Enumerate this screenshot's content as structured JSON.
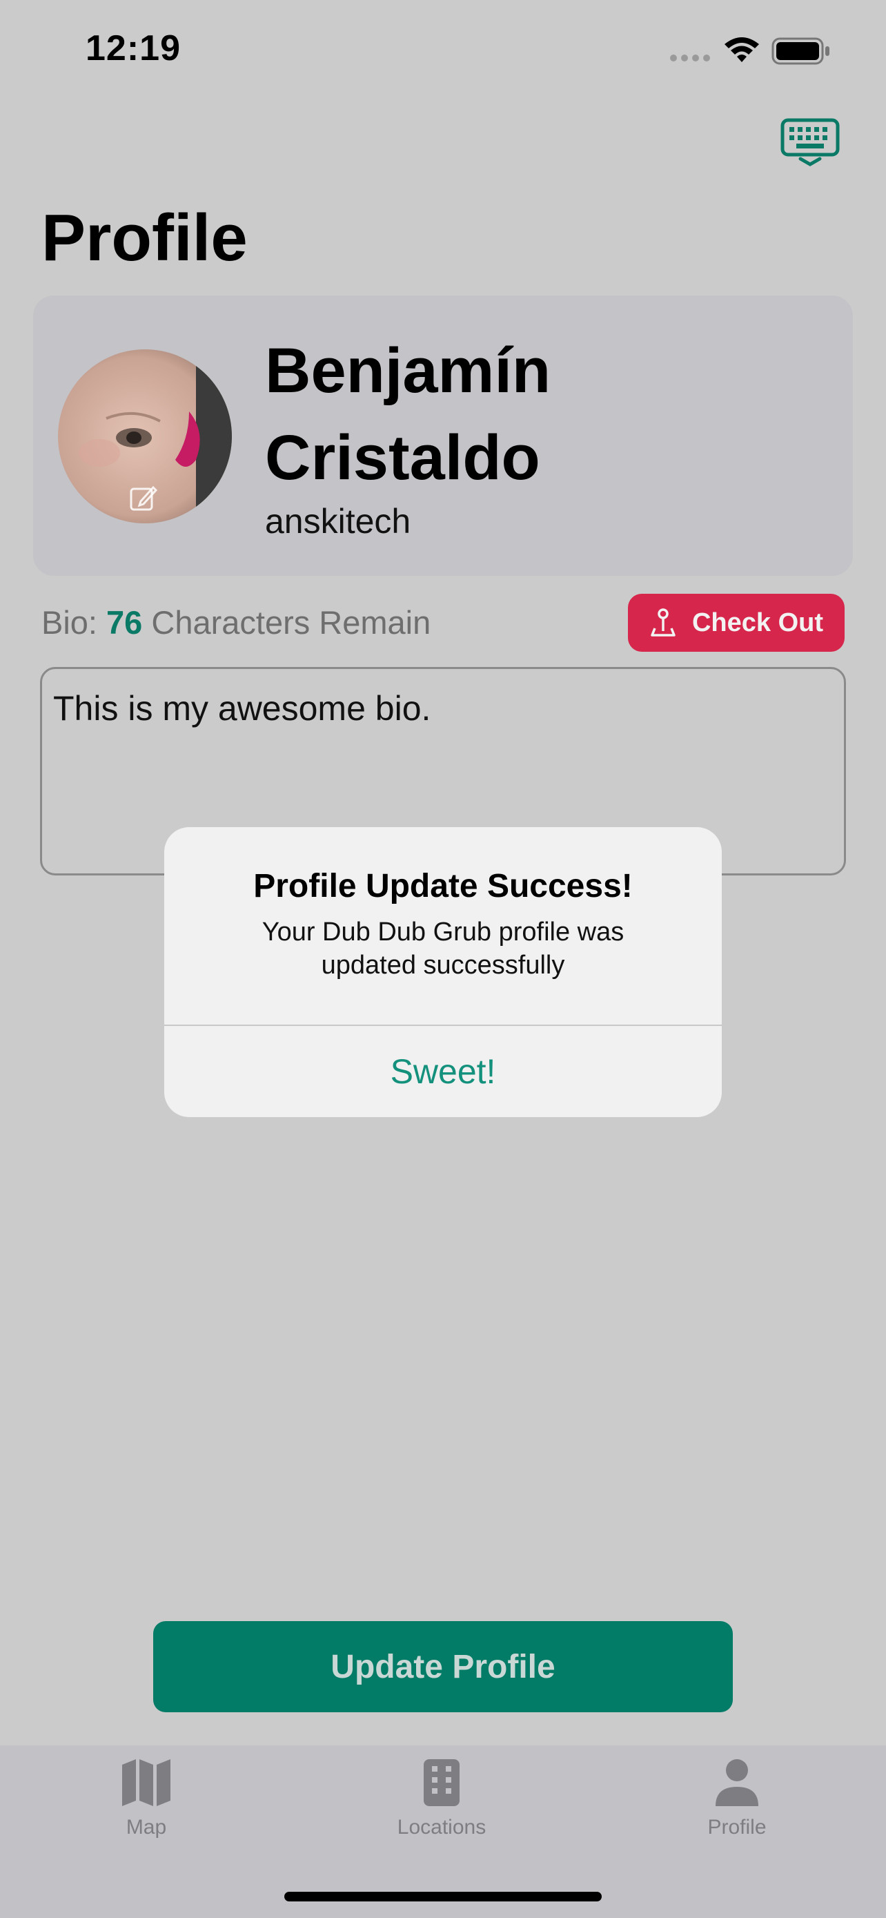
{
  "status_bar": {
    "time": "12:19"
  },
  "page": {
    "title": "Profile"
  },
  "profile": {
    "first_name": "Benjamín",
    "last_name": "Cristaldo",
    "username": "anskitech"
  },
  "bio": {
    "label_prefix": "Bio: ",
    "remaining_count": "76",
    "label_suffix": " Characters Remain",
    "text": "This is my awesome bio."
  },
  "check_out": {
    "label": "Check Out"
  },
  "alert": {
    "title": "Profile Update Success!",
    "message": "Your Dub Dub Grub profile was updated successfully",
    "action": "Sweet!"
  },
  "update_button": {
    "label": "Update Profile"
  },
  "tabs": [
    {
      "label": "Map",
      "icon": "map-icon"
    },
    {
      "label": "Locations",
      "icon": "building-icon"
    },
    {
      "label": "Profile",
      "icon": "person-icon"
    }
  ],
  "colors": {
    "accent": "#027b67",
    "check_out": "#d6264c",
    "background": "#cbcbcb"
  }
}
